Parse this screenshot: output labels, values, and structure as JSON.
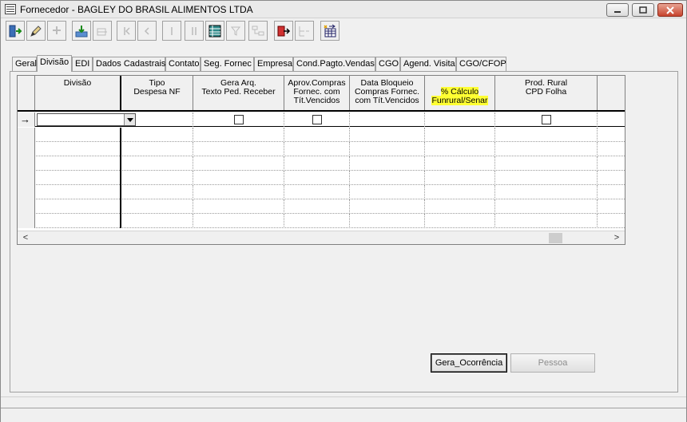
{
  "window": {
    "title": "Fornecedor - BAGLEY DO BRASIL ALIMENTOS LTDA",
    "controls": {
      "minimize": "▭",
      "maximize": "▣",
      "close": "✕"
    }
  },
  "toolbar": {
    "buttons": [
      {
        "name": "exit-icon",
        "enabled": true
      },
      {
        "name": "edit-icon",
        "enabled": true
      },
      {
        "name": "new-record-icon",
        "enabled": false
      },
      {
        "name": "save-icon",
        "enabled": true
      },
      {
        "name": "delete-record-icon",
        "enabled": false
      },
      {
        "name": "first-record-icon",
        "enabled": false
      },
      {
        "name": "previous-record-icon",
        "enabled": false
      },
      {
        "name": "next-record-icon",
        "enabled": false
      },
      {
        "name": "last-record-icon",
        "enabled": false
      },
      {
        "name": "grid-view-icon",
        "enabled": true
      },
      {
        "name": "filter-icon",
        "enabled": false
      },
      {
        "name": "tree-icon",
        "enabled": false
      },
      {
        "name": "export-icon",
        "enabled": true
      },
      {
        "name": "tree-collapse-icon",
        "enabled": false
      },
      {
        "name": "spreadsheet-icon",
        "enabled": true
      }
    ]
  },
  "tabs": [
    {
      "label": "Geral"
    },
    {
      "label": "Divisão",
      "active": true
    },
    {
      "label": "EDI"
    },
    {
      "label": "Dados Cadastrais"
    },
    {
      "label": "Contato"
    },
    {
      "label": "Seg. Fornec"
    },
    {
      "label": "Empresa"
    },
    {
      "label": "Cond.Pagto.Vendas"
    },
    {
      "label": "CGO"
    },
    {
      "label": "Agend. Visita"
    },
    {
      "label": "CGO/CFOP"
    }
  ],
  "grid": {
    "columns": [
      {
        "label": "Divisão"
      },
      {
        "label": "Tipo\nDespesa NF"
      },
      {
        "label": "Gera Arq.\nTexto Ped. Receber"
      },
      {
        "label": "Aprov.Compras\nFornec. com\nTít.Vencidos"
      },
      {
        "label": "Data Bloqueio\nCompras Fornec.\ncom Tít.Vencidos"
      },
      {
        "label": "% Cálculo\nFunrural/Senar",
        "highlighted": true
      },
      {
        "label": "Prod. Rural\nCPD Folha"
      },
      {
        "label": ""
      }
    ],
    "current_row_indicator": "→",
    "scroll_left": "<",
    "scroll_right": ">"
  },
  "buttons": {
    "gera_ocorrencia": "Gera_Ocorrência",
    "pessoa": "Pessoa"
  },
  "colors": {
    "highlight": "#ffff33",
    "window_bg": "#f0f0f0"
  }
}
